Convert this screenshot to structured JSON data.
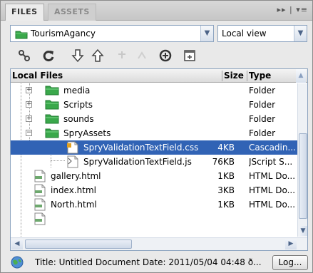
{
  "tabs": [
    {
      "label": "FILES",
      "active": true
    },
    {
      "label": "ASSETS",
      "active": false
    }
  ],
  "tab_controls": "▸▸ | ▾≡",
  "site_select": {
    "value": "TourismAgancy"
  },
  "view_select": {
    "value": "Local view"
  },
  "toolbar": [
    {
      "icon": "connect-icon"
    },
    {
      "icon": "refresh-icon"
    },
    {
      "icon": "get-files-icon"
    },
    {
      "icon": "put-files-icon"
    },
    {
      "icon": "checkout-icon",
      "disabled": true
    },
    {
      "icon": "checkin-icon",
      "disabled": true
    },
    {
      "icon": "synchronize-icon"
    },
    {
      "icon": "expand-icon"
    }
  ],
  "columns": {
    "name": "Local Files",
    "size": "Size",
    "type": "Type"
  },
  "rows": [
    {
      "name": "media",
      "size": "",
      "type": "Folder",
      "kind": "folder",
      "level": 1,
      "expand": "+"
    },
    {
      "name": "Scripts",
      "size": "",
      "type": "Folder",
      "kind": "folder",
      "level": 1,
      "expand": "+"
    },
    {
      "name": "sounds",
      "size": "",
      "type": "Folder",
      "kind": "folder",
      "level": 1,
      "expand": "+"
    },
    {
      "name": "SpryAssets",
      "size": "",
      "type": "Folder",
      "kind": "folder",
      "level": 1,
      "expand": "−"
    },
    {
      "name": "SpryValidationTextField.css",
      "size": "4KB",
      "type": "Cascadin...",
      "kind": "css",
      "level": 2,
      "selected": true
    },
    {
      "name": "SpryValidationTextField.js",
      "size": "76KB",
      "type": "JScript S...",
      "kind": "js",
      "level": 2
    },
    {
      "name": "gallery.html",
      "size": "1KB",
      "type": "HTML Do...",
      "kind": "html",
      "level": 0
    },
    {
      "name": "index.html",
      "size": "3KB",
      "type": "HTML Do...",
      "kind": "html",
      "level": 0
    },
    {
      "name": "North.html",
      "size": "1KB",
      "type": "HTML Do...",
      "kind": "html",
      "level": 0
    },
    {
      "name": "",
      "size": "",
      "type": "",
      "kind": "html",
      "level": 0
    }
  ],
  "status": {
    "text": "Title: Untitled Document  Date: 2011/05/04 04:48 ð...",
    "log_label": "Log..."
  },
  "colors": {
    "selection": "#3163b5",
    "folder": "#3aa84b",
    "border": "#8da4c0"
  }
}
